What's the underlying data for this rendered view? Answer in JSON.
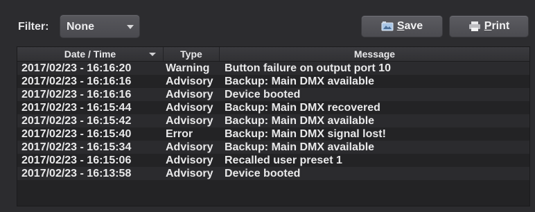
{
  "toolbar": {
    "filter_label": "Filter:",
    "filter_value": "None",
    "save_label_mnemonic": "S",
    "save_label_rest": "ave",
    "print_label_mnemonic": "P",
    "print_label_rest": "rint"
  },
  "icons": {
    "save": "save-icon",
    "print": "printer-icon",
    "filter_dropdown": "chevron-down-icon",
    "sort": "sort-descending-icon"
  },
  "table": {
    "columns": [
      "Date / Time",
      "Type",
      "Message"
    ],
    "rows": [
      {
        "datetime": "2017/02/23 - 16:16:20",
        "type": "Warning",
        "message": "Button failure on output port 10"
      },
      {
        "datetime": "2017/02/23 - 16:16:16",
        "type": "Advisory",
        "message": "Backup: Main DMX available"
      },
      {
        "datetime": "2017/02/23 - 16:16:16",
        "type": "Advisory",
        "message": "Device booted"
      },
      {
        "datetime": "2017/02/23 - 16:15:44",
        "type": "Advisory",
        "message": "Backup: Main DMX recovered"
      },
      {
        "datetime": "2017/02/23 - 16:15:42",
        "type": "Advisory",
        "message": "Backup: Main DMX available"
      },
      {
        "datetime": "2017/02/23 - 16:15:40",
        "type": "Error",
        "message": "Backup: Main DMX signal lost!"
      },
      {
        "datetime": "2017/02/23 - 16:15:34",
        "type": "Advisory",
        "message": "Backup: Main DMX available"
      },
      {
        "datetime": "2017/02/23 - 16:15:06",
        "type": "Advisory",
        "message": "Recalled user preset 1"
      },
      {
        "datetime": "2017/02/23 - 16:13:58",
        "type": "Advisory",
        "message": "Device booted"
      }
    ]
  },
  "colors": {
    "background": "#2c2c2f",
    "table_background": "#232325",
    "row_alt": "#2b2b2e",
    "text": "#e9e9ea"
  }
}
